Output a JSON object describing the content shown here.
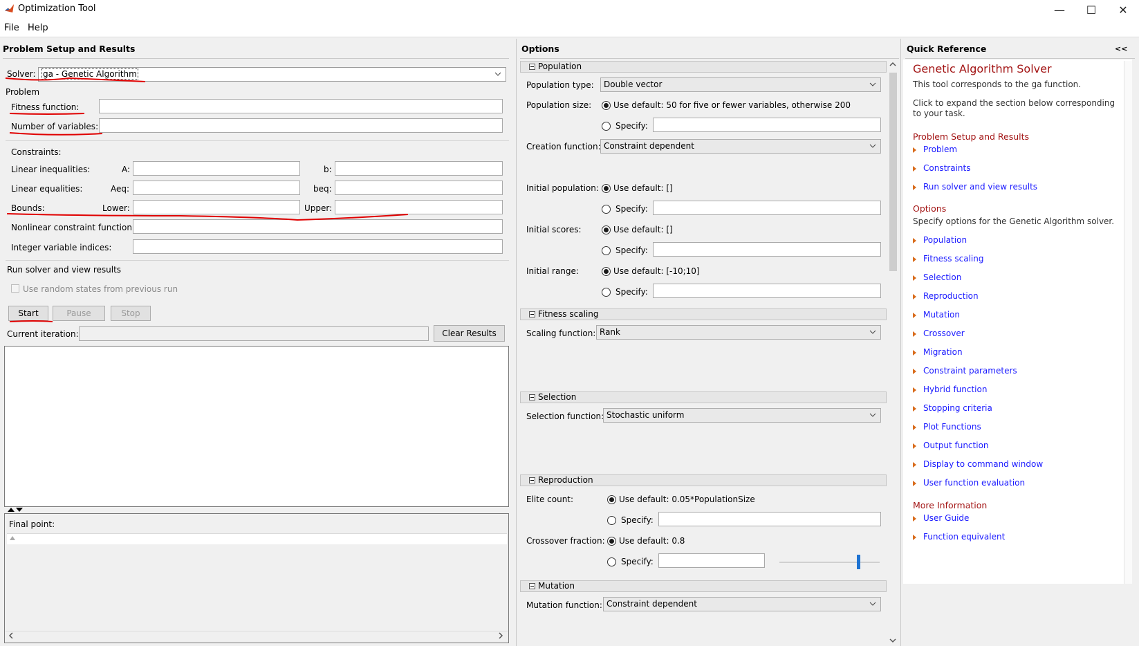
{
  "window": {
    "title": "Optimization Tool",
    "min": "—",
    "max": "☐",
    "close": "✕"
  },
  "menu": {
    "file": "File",
    "help": "Help"
  },
  "left": {
    "header": "Problem Setup and Results",
    "solver_label": "Solver:",
    "solver_value": "ga - Genetic Algorithm",
    "problem_group": "Problem",
    "fitness_label": "Fitness function:",
    "nvars_label": "Number of variables:",
    "constraints_label": "Constraints:",
    "lin_ineq_label": "Linear inequalities:",
    "A_label": "A:",
    "b_label": "b:",
    "lin_eq_label": "Linear equalities:",
    "Aeq_label": "Aeq:",
    "beq_label": "beq:",
    "bounds_label": "Bounds:",
    "lower_label": "Lower:",
    "upper_label": "Upper:",
    "nonlcon_label": "Nonlinear constraint function:",
    "intcon_label": "Integer variable indices:",
    "run_group": "Run solver and view results",
    "random_states": "Use random states from previous run",
    "start": "Start",
    "pause": "Pause",
    "stop": "Stop",
    "current_iteration": "Current iteration:",
    "clear_results": "Clear Results",
    "final_point": "Final point:"
  },
  "options": {
    "header": "Options",
    "population": {
      "title": "Population",
      "type_label": "Population type:",
      "type_value": "Double vector",
      "size_label": "Population size:",
      "size_default": "Use default: 50 for five or fewer variables, otherwise 200",
      "specify": "Specify:",
      "creation_label": "Creation function:",
      "creation_value": "Constraint dependent",
      "initpop_label": "Initial population:",
      "initpop_default": "Use default: []",
      "initscores_label": "Initial scores:",
      "initscores_default": "Use default: []",
      "initrange_label": "Initial range:",
      "initrange_default": "Use default: [-10;10]"
    },
    "fitness_scaling": {
      "title": "Fitness scaling",
      "label": "Scaling function:",
      "value": "Rank"
    },
    "selection": {
      "title": "Selection",
      "label": "Selection function:",
      "value": "Stochastic uniform"
    },
    "reproduction": {
      "title": "Reproduction",
      "elite_label": "Elite count:",
      "elite_default": "Use default: 0.05*PopulationSize",
      "crossover_label": "Crossover fraction:",
      "crossover_default": "Use default: 0.8",
      "specify": "Specify:"
    },
    "mutation": {
      "title": "Mutation",
      "label": "Mutation function:",
      "value": "Constraint dependent"
    }
  },
  "quick_reference": {
    "header": "Quick Reference",
    "collapse": "<<",
    "title": "Genetic Algorithm Solver",
    "intro1": "This tool corresponds to the ga function.",
    "intro2": "Click to expand the section below corresponding to your task.",
    "psr_head": "Problem Setup and Results",
    "psr_links": [
      "Problem",
      "Constraints",
      "Run solver and view results"
    ],
    "options_head": "Options",
    "options_desc": "Specify options for the Genetic Algorithm solver.",
    "options_links": [
      "Population",
      "Fitness scaling",
      "Selection",
      "Reproduction",
      "Mutation",
      "Crossover",
      "Migration",
      "Constraint parameters",
      "Hybrid function",
      "Stopping criteria",
      "Plot Functions",
      "Output function",
      "Display to command window",
      "User function evaluation"
    ],
    "more_head": "More Information",
    "more_links": [
      "User Guide",
      "Function equivalent"
    ]
  },
  "colors": {
    "annotation": "#e00000",
    "link": "#1a1aff",
    "qr_heading": "#a31515",
    "accent_slider": "#1e73d2"
  }
}
